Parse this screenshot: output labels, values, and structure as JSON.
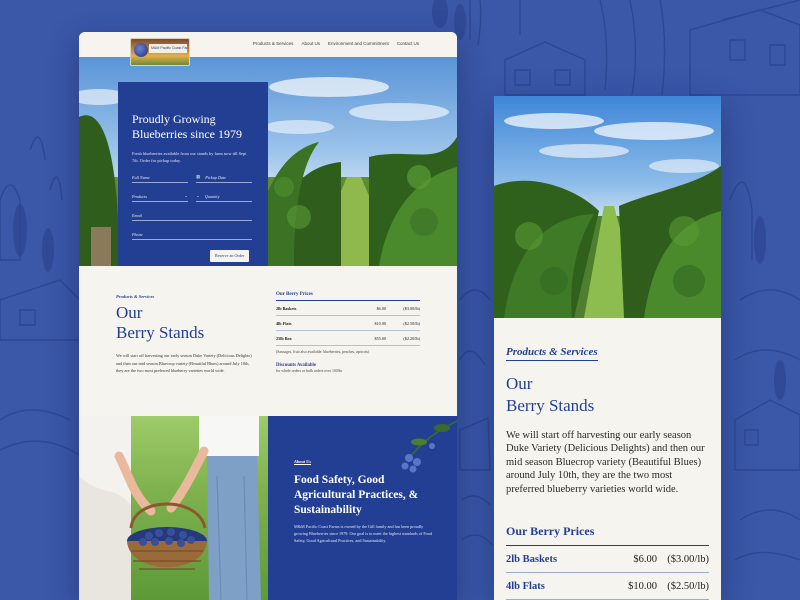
{
  "colors": {
    "brand_blue": "#233f94",
    "background_blue": "#3a57a8",
    "cream": "#f6f4ee"
  },
  "desktop": {
    "nav": [
      "Products & Services",
      "About Us",
      "Environment and Commitment",
      "Contact Us"
    ],
    "hero": {
      "title": "Proudly Growing Blueberries since 1979",
      "text": "Fresh blueberries available from our stands by farm now till Sept 7th. Order for pickup today.",
      "fields": {
        "full_name": "Full Name",
        "pickup_date": "Pickup Date",
        "products": "Products",
        "quantity": "Quantity",
        "email": "Email",
        "phone": "Phone"
      },
      "reserve_button": "Reserve an Order"
    },
    "stands": {
      "eyebrow": "Products & Services",
      "title_line1": "Our",
      "title_line2": "Berry Stands",
      "text": "We will start off harvesting our early season Duke Variety (Delicious Delights) and then our mid season Bluecrop variety (Beautiful Blues) around July 10th, they are the two most preferred blueberry varieties world wide.",
      "prices_title": "Our Berry Prices",
      "prices": [
        {
          "name": "2lb Baskets",
          "price": "$6.00",
          "unit": "($3.00/lb)"
        },
        {
          "name": "4lb Flats",
          "price": "$10.00",
          "unit": "($2.50/lb)"
        },
        {
          "name": "25lb Box",
          "price": "$55.00",
          "unit": "($2.20/lb)"
        }
      ],
      "prices_note": "(Sausages, fruit also available: blueberries, peaches, apricots)",
      "discounts_title": "Discounts Available",
      "discounts_text": "for whole orders or bulk orders over 100lbs"
    },
    "safety": {
      "eyebrow": "About Us",
      "title": "Food Safety, Good Agricultural Practices, & Sustainability",
      "text": "M&M Pacific Coast Farms is owned by the Gill family and has been proudly growing Blueberries since 1979. Our goal is to meet the highest standards of Food Safety, Good Agricultural Practices, and Sustainability."
    }
  },
  "mobile": {
    "eyebrow": "Products & Services",
    "title_line1": "Our",
    "title_line2": "Berry Stands",
    "text": "We will start off harvesting our early season Duke Variety (Delicious Delights) and then our mid season Bluecrop variety (Beautiful Blues) around July 10th, they are the two most preferred blueberry varieties world wide.",
    "prices_title": "Our Berry Prices",
    "prices": [
      {
        "name": "2lb Baskets",
        "price": "$6.00",
        "unit": "($3.00/lb)"
      },
      {
        "name": "4lb Flats",
        "price": "$10.00",
        "unit": "($2.50/lb)"
      }
    ]
  }
}
